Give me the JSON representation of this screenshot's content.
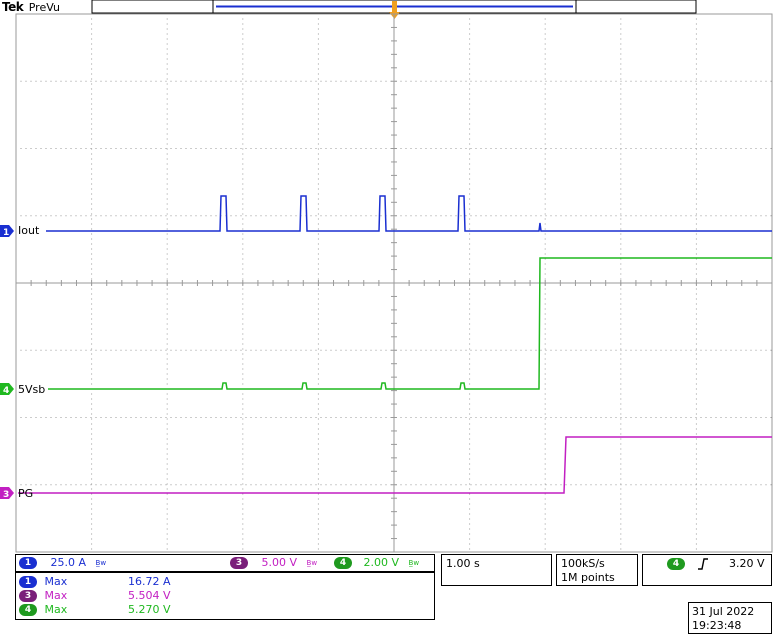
{
  "header": {
    "brand": "Tek",
    "mode": "PreVu"
  },
  "colors": {
    "ch1": "#1a2fd1",
    "ch3": "#c21fc2",
    "ch4": "#1fb81f",
    "grid": "#9a9a9a"
  },
  "traces": [
    {
      "id": "ch1",
      "label": "Iout",
      "marker": "1"
    },
    {
      "id": "ch4",
      "label": "5Vsb",
      "marker": "4"
    },
    {
      "id": "ch3",
      "label": "PG",
      "marker": "3"
    }
  ],
  "settings": {
    "ch1": {
      "num": "1",
      "scale": "25.0 A"
    },
    "ch3": {
      "num": "3",
      "scale": "5.00 V"
    },
    "ch4": {
      "num": "4",
      "scale": "2.00 V"
    },
    "bw_mark": "B̲w"
  },
  "timebase": {
    "scale": "1.00 s",
    "rate": "100kS/s",
    "points": "1M points"
  },
  "trigger": {
    "source": "4",
    "slope_icon": "rising-edge-icon",
    "level": "3.20 V"
  },
  "measurements": [
    {
      "num": "1",
      "name": "Max",
      "value": "16.72 A",
      "color": "#1a2fd1"
    },
    {
      "num": "3",
      "name": "Max",
      "value": "5.504 V",
      "color": "#c21fc2"
    },
    {
      "num": "4",
      "name": "Max",
      "value": "5.270 V",
      "color": "#1fb81f"
    }
  ],
  "datetime": {
    "date": "31 Jul  2022",
    "time": "19:23:48"
  }
}
